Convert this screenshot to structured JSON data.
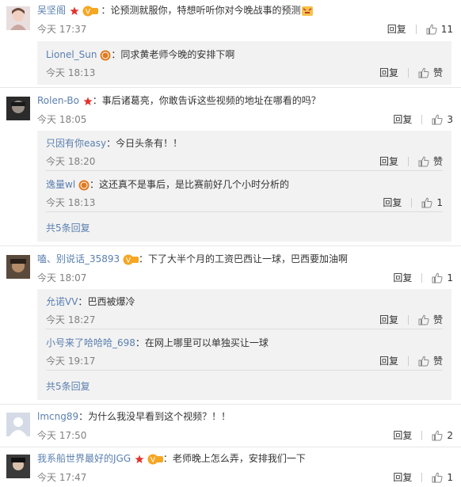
{
  "colors": {
    "username": "#5a7fb0",
    "reply_bg": "#f2f2f2",
    "meta": "#808080",
    "badge_red": "#e2322b",
    "vip_orange": "#f6a623"
  },
  "icons": {
    "like": "thumbs-up-icon",
    "star": "star-icon",
    "vip": "vip-badge-icon",
    "medal": "medal-icon",
    "emoji": "angry-emoji-icon"
  },
  "labels": {
    "reply": "回复",
    "like": "赞"
  },
  "comments": [
    {
      "user": "吴坚阁",
      "sep": "：",
      "text": "论预测就服你，特想听听你对今晚战事的预测",
      "time": "今天 17:37",
      "reply": "回复",
      "likes": "11",
      "replies": [
        {
          "user": "Lionel_Sun",
          "sep": "：",
          "text": "同求黄老师今晚的安排下啊",
          "time": "今天 18:13",
          "reply": "回复",
          "likes": "赞"
        }
      ]
    },
    {
      "user": "Rolen-Bo",
      "sep": "：",
      "text": "事后诸葛亮，你敢告诉这些视频的地址在哪看的吗？",
      "time": "今天 18:05",
      "reply": "回复",
      "likes": "3",
      "replies": [
        {
          "user": "只因有你easy",
          "sep": "：",
          "text": "今日头条有！！",
          "time": "今天 18:20",
          "reply": "回复",
          "likes": "赞"
        },
        {
          "user": "逸量wl",
          "sep": "：",
          "text": "这还真不是事后，是比赛前好几个小时分析的",
          "time": "今天 18:13",
          "reply": "回复",
          "likes": "1"
        }
      ],
      "more": "共5条回复"
    },
    {
      "user": "嗑、别说话_35893",
      "sep": "：",
      "text": "下了大半个月的工资巴西让一球，巴西要加油啊",
      "time": "今天 18:07",
      "reply": "回复",
      "likes": "1",
      "replies": [
        {
          "user": "允诺VV",
          "sep": "：",
          "text": "巴西被爆冷",
          "time": "今天 18:27",
          "reply": "回复",
          "likes": "赞"
        },
        {
          "user": "小号来了哈哈哈_698",
          "sep": "：",
          "text": "在网上哪里可以单独买让一球",
          "time": "今天 19:17",
          "reply": "回复",
          "likes": "赞"
        }
      ],
      "more": "共5条回复"
    },
    {
      "user": "lmcng89",
      "sep": "：",
      "text": "为什么我没早看到这个视频？！！",
      "time": "今天 17:50",
      "reply": "回复",
      "likes": "2"
    },
    {
      "user": "我系船世界最好的JGG",
      "sep": "：",
      "text": "老师晚上怎么弄，安排我们一下",
      "time": "今天 17:47",
      "reply": "回复",
      "likes": "1"
    }
  ]
}
